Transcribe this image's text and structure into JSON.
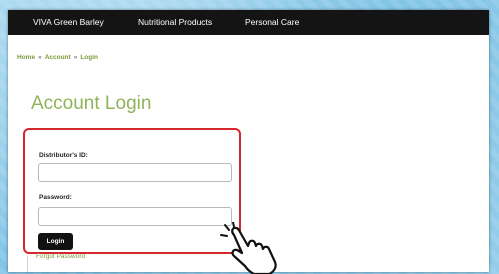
{
  "nav": {
    "items": [
      "VIVA Green Barley",
      "Nutritional Products",
      "Personal Care"
    ]
  },
  "breadcrumb": {
    "items": [
      "Home",
      "Account",
      "Login"
    ],
    "separator": "»"
  },
  "page_title": "Account Login",
  "form": {
    "distributor_id_label": "Distributor's ID:",
    "distributor_id_value": "",
    "password_label": "Password:",
    "password_value": "",
    "login_button": "Login"
  },
  "forgot_password": "Forgot Password",
  "colors": {
    "navbar": "#141414",
    "accent_green": "#8fb35a",
    "highlight_red": "#d6262e",
    "button": "#111111"
  },
  "cursor": {
    "icon": "hand-pointer-icon"
  }
}
